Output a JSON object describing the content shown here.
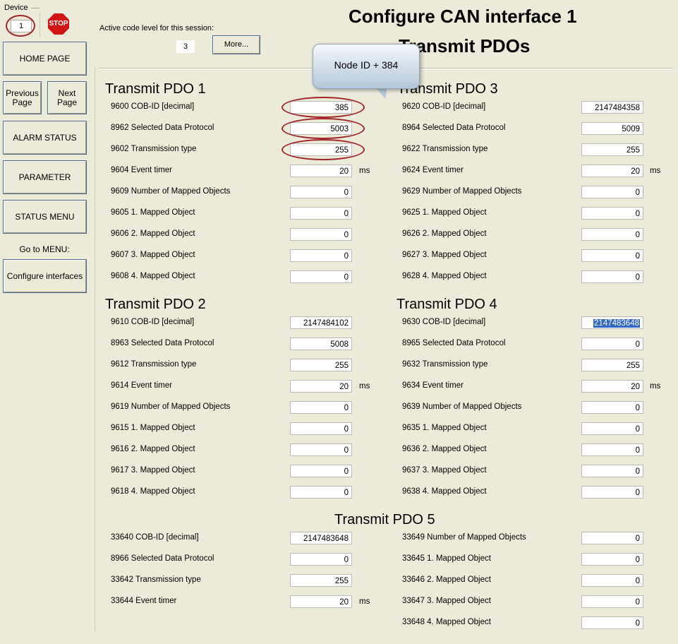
{
  "device": {
    "label": "Device",
    "value": "1",
    "stop_label": "STOP"
  },
  "nav": {
    "home": "HOME PAGE",
    "previous": "Previous Page",
    "next": "Next Page",
    "alarm": "ALARM STATUS",
    "parameter": "PARAMETER",
    "status": "STATUS MENU",
    "goto_label": "Go to MENU:",
    "configure": "Configure interfaces"
  },
  "header": {
    "code_label": "Active code level for this session:",
    "code_value": "3",
    "more_label": "More...",
    "title": "Configure CAN interface 1",
    "subtitle": "Transmit PDOs"
  },
  "callout": {
    "text": "Node ID + 384"
  },
  "unit_ms": "ms",
  "pdo1": {
    "title": "Transmit PDO 1",
    "fields": [
      {
        "label": "9600 COB-ID [decimal]",
        "value": "385"
      },
      {
        "label": "8962 Selected Data Protocol",
        "value": "5003"
      },
      {
        "label": "9602 Transmission type",
        "value": "255"
      },
      {
        "label": "9604 Event timer",
        "value": "20"
      },
      {
        "label": "9609 Number of Mapped Objects",
        "value": "0"
      },
      {
        "label": "9605 1. Mapped Object",
        "value": "0"
      },
      {
        "label": "9606 2. Mapped Object",
        "value": "0"
      },
      {
        "label": "9607 3. Mapped Object",
        "value": "0"
      },
      {
        "label": "9608 4. Mapped Object",
        "value": "0"
      }
    ]
  },
  "pdo2": {
    "title": "Transmit PDO 2",
    "fields": [
      {
        "label": "9610 COB-ID [decimal]",
        "value": "2147484102"
      },
      {
        "label": "8963 Selected Data Protocol",
        "value": "5008"
      },
      {
        "label": "9612 Transmission type",
        "value": "255"
      },
      {
        "label": "9614 Event timer",
        "value": "20"
      },
      {
        "label": "9619 Number of Mapped Objects",
        "value": "0"
      },
      {
        "label": "9615 1. Mapped Object",
        "value": "0"
      },
      {
        "label": "9616 2. Mapped Object",
        "value": "0"
      },
      {
        "label": "9617 3. Mapped Object",
        "value": "0"
      },
      {
        "label": "9618 4. Mapped Object",
        "value": "0"
      }
    ]
  },
  "pdo3": {
    "title": "Transmit PDO 3",
    "fields": [
      {
        "label": "9620 COB-ID [decimal]",
        "value": "2147484358"
      },
      {
        "label": "8964 Selected Data Protocol",
        "value": "5009"
      },
      {
        "label": "9622 Transmission type",
        "value": "255"
      },
      {
        "label": "9624 Event timer",
        "value": "20"
      },
      {
        "label": "9629 Number of Mapped Objects",
        "value": "0"
      },
      {
        "label": "9625 1. Mapped Object",
        "value": "0"
      },
      {
        "label": "9626 2. Mapped Object",
        "value": "0"
      },
      {
        "label": "9627 3. Mapped Object",
        "value": "0"
      },
      {
        "label": "9628 4. Mapped Object",
        "value": "0"
      }
    ]
  },
  "pdo4": {
    "title": "Transmit PDO 4",
    "fields": [
      {
        "label": "9630 COB-ID [decimal]",
        "value": "2147483648"
      },
      {
        "label": "8965 Selected Data Protocol",
        "value": "0"
      },
      {
        "label": "9632 Transmission type",
        "value": "255"
      },
      {
        "label": "9634 Event timer",
        "value": "20"
      },
      {
        "label": "9639 Number of Mapped Objects",
        "value": "0"
      },
      {
        "label": "9635 1. Mapped Object",
        "value": "0"
      },
      {
        "label": "9636 2. Mapped Object",
        "value": "0"
      },
      {
        "label": "9637 3. Mapped Object",
        "value": "0"
      },
      {
        "label": "9638 4. Mapped Object",
        "value": "0"
      }
    ]
  },
  "pdo5": {
    "title": "Transmit PDO 5",
    "left": [
      {
        "label": "33640 COB-ID [decimal]",
        "value": "2147483648"
      },
      {
        "label": "8966 Selected Data Protocol",
        "value": "0"
      },
      {
        "label": "33642 Transmission type",
        "value": "255"
      },
      {
        "label": "33644 Event timer",
        "value": "20"
      }
    ],
    "right": [
      {
        "label": "33649 Number of Mapped Objects",
        "value": "0"
      },
      {
        "label": "33645 1. Mapped Object",
        "value": "0"
      },
      {
        "label": "33646 2. Mapped Object",
        "value": "0"
      },
      {
        "label": "33647 3. Mapped Object",
        "value": "0"
      },
      {
        "label": "33648 4. Mapped Object",
        "value": "0"
      }
    ]
  }
}
